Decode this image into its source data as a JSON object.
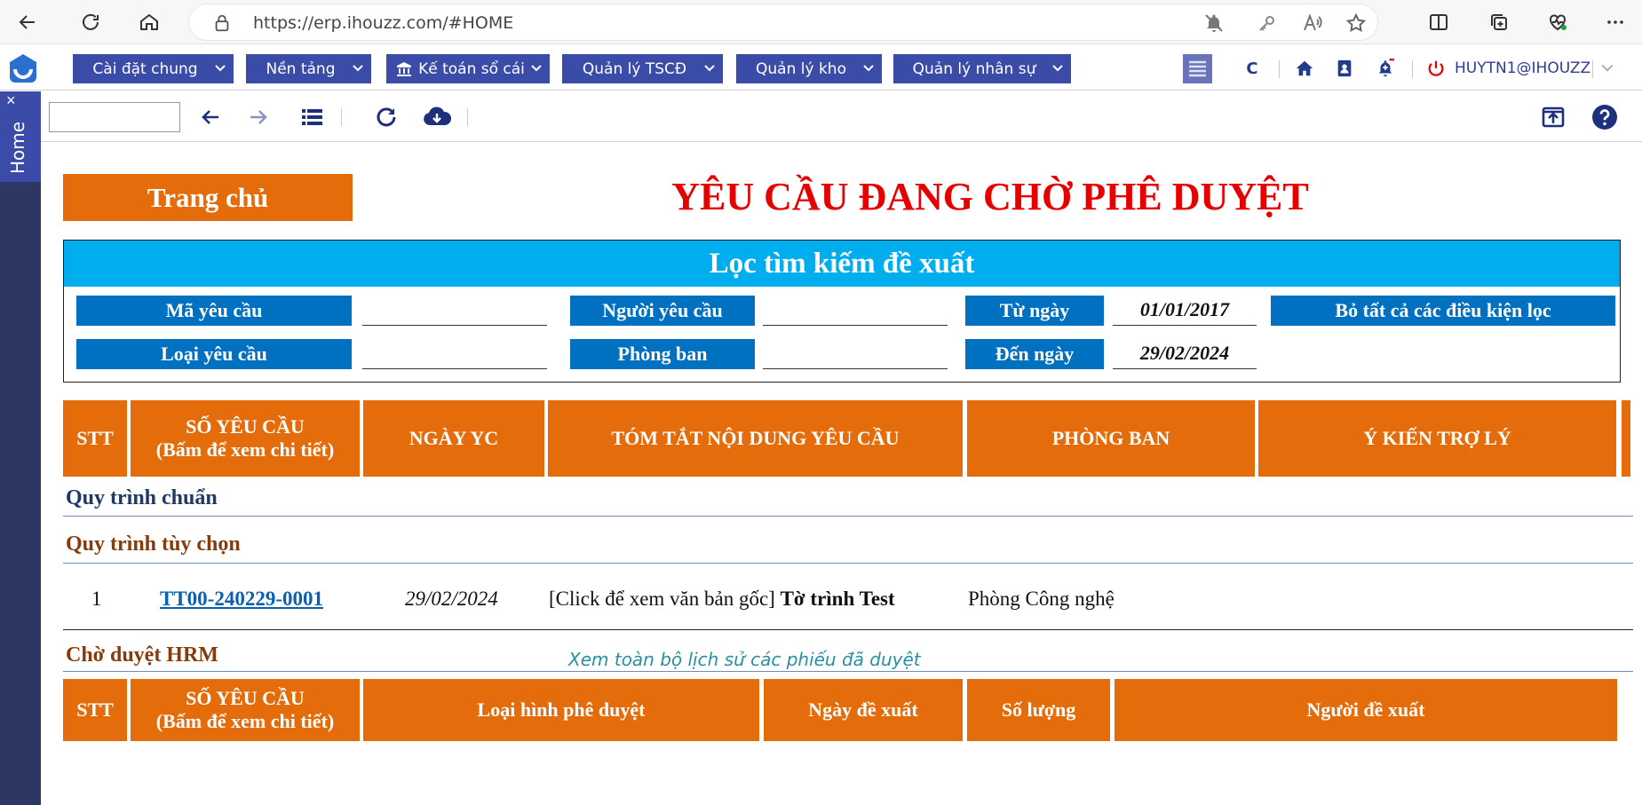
{
  "browser": {
    "url": "https://erp.ihouzz.com/#HOME"
  },
  "app": {
    "menus": [
      {
        "label": "Cài đặt chung"
      },
      {
        "label": "Nền tảng"
      },
      {
        "label": "Kế toán sổ cái"
      },
      {
        "label": "Quản lý TSCĐ"
      },
      {
        "label": "Quản lý kho"
      },
      {
        "label": "Quản lý nhân sự"
      }
    ],
    "c_label": "C",
    "user": "HUYTN1@IHOUZZ"
  },
  "sidetab": {
    "close": "×",
    "label": "Home"
  },
  "content": {
    "home_button": "Trang chủ",
    "title": "YÊU CẦU ĐANG CHỜ PHÊ DUYỆT",
    "filter": {
      "heading": "Lọc tìm kiếm đề xuất",
      "labels": {
        "ma_yeu_cau": "Mã yêu cầu",
        "loai_yeu_cau": "Loại yêu cầu",
        "nguoi_yeu_cau": "Người yêu cầu",
        "phong_ban": "Phòng ban",
        "tu_ngay": "Từ ngày",
        "den_ngay": "Đến ngày",
        "clear": "Bỏ tất cả các điều kiện lọc"
      },
      "values": {
        "tu_ngay": "01/01/2017",
        "den_ngay": "29/02/2024"
      }
    },
    "table1": {
      "headers": {
        "stt": "STT",
        "so_yeu_cau_1": "SỐ YÊU CẦU",
        "so_yeu_cau_2": "(Bấm để xem chi tiết)",
        "ngay_yc": "NGÀY YC",
        "tom_tat": "TÓM TẮT NỘI DUNG YÊU CẦU",
        "phong_ban": "PHÒNG BAN",
        "y_kien": "Ý KIẾN TRỢ LÝ"
      }
    },
    "sections": {
      "chuan": "Quy trình chuẩn",
      "tuy_chon": "Quy trình tùy chọn",
      "hrm": "Chờ duyệt HRM"
    },
    "rows": [
      {
        "stt": "1",
        "so": "TT00-240229-0001",
        "ngay": "29/02/2024",
        "summary_prefix": "[Click để xem văn bản gốc]",
        "summary_bold": "Tờ trình Test",
        "phong_ban": "Phòng Công nghệ"
      }
    ],
    "history_link": "Xem toàn bộ lịch sử các phiếu đã duyệt",
    "table2": {
      "headers": {
        "stt": "STT",
        "so_yeu_cau_1": "SỐ YÊU CẦU",
        "so_yeu_cau_2": "(Bấm để xem chi tiết)",
        "loai_hinh": "Loại hình phê duyệt",
        "ngay_de_xuat": "Ngày đề xuất",
        "so_luong": "Số lượng",
        "nguoi_de_xuat": "Người đề xuất"
      }
    }
  },
  "colors": {
    "orange": "#e46c0a",
    "filter_blue": "#00aeef",
    "label_blue": "#0070c0",
    "menu_blue": "#3b4ba8",
    "title_red": "#e60000",
    "section_navy": "#1f3864",
    "section_brown": "#843c0c"
  }
}
